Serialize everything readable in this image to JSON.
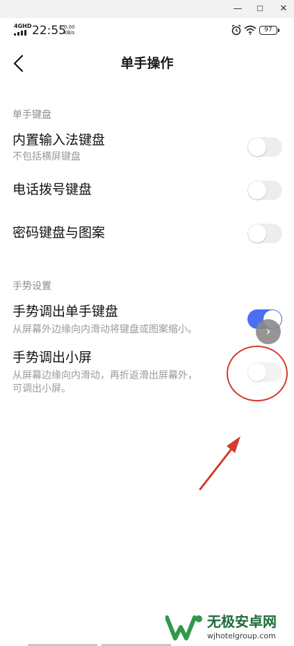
{
  "window_controls": {
    "minimize": "—",
    "maximize": "☐",
    "close": "✕"
  },
  "status_bar": {
    "network": "4GHD",
    "time": "22:55",
    "speed_value": "0.00",
    "speed_unit": "KB/s",
    "battery": "97"
  },
  "header": {
    "title": "单手操作",
    "back_icon": "chevron-left-icon"
  },
  "sections": [
    {
      "heading": "单手键盘",
      "items": [
        {
          "label": "内置输入法键盘",
          "sub": "不包括横屏键盘",
          "on": false
        },
        {
          "label": "电话拨号键盘",
          "on": false
        },
        {
          "label": "密码键盘与图案",
          "on": false
        }
      ]
    },
    {
      "heading": "手势设置",
      "items": [
        {
          "label": "手势调出单手键盘",
          "sub": "从屏幕外边缘向内滑动将键盘或图案缩小。",
          "on": true
        },
        {
          "label": "手势调出小屏",
          "sub_line1": "从屏幕边缘向内滑动，再折返滑出屏幕外，",
          "sub_line2": "可调出小屏。",
          "on": false
        }
      ]
    }
  ],
  "floating_button": {
    "icon": "chevron-right-icon",
    "glyph": "›"
  },
  "annotation": {
    "color": "#d23a2e"
  },
  "colors": {
    "toggle_on": "#4a6ff0",
    "toggle_off": "#ededed",
    "watermark_green": "#1f6b3a"
  },
  "watermark": {
    "name": "无极安卓网",
    "url": "wjhotelgroup.com"
  }
}
